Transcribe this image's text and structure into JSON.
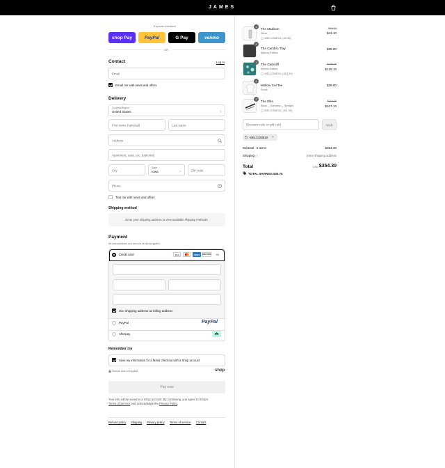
{
  "header": {
    "brand": "JAMES"
  },
  "express": {
    "title": "Express checkout",
    "buttons": [
      {
        "label": "shop Pay",
        "color": "#5a31f4"
      },
      {
        "label": "PayPal",
        "color": "#ffc439"
      },
      {
        "label": "G Pay",
        "color": "#000000"
      },
      {
        "label": "venmo",
        "color": "#3d95ce"
      }
    ],
    "or": "OR"
  },
  "contact": {
    "title": "Contact",
    "login": "Log in",
    "email_placeholder": "Email",
    "news_label": "Email me with news and offers"
  },
  "delivery": {
    "title": "Delivery",
    "country_label": "Country/Region",
    "country_value": "United States",
    "first_name": "First name (optional)",
    "last_name": "Last name",
    "address": "Address",
    "apartment": "Apartment, suite, etc. (optional)",
    "city": "City",
    "state_label": "State",
    "state_value": "Iowa",
    "zip": "ZIP code",
    "phone": "Phone",
    "text_label": "Text me with news and offers"
  },
  "shipping": {
    "title": "Shipping method",
    "note": "Enter your shipping address to view available shipping methods."
  },
  "payment": {
    "title": "Payment",
    "subtitle": "All transactions are secure and encrypted.",
    "credit_card": "Credit card",
    "card_logos": [
      "Visa",
      "MC",
      "AMEX",
      "DISCOVER"
    ],
    "more": "+5",
    "billing_label": "Use shipping address as billing address",
    "paypal": "PayPal",
    "paypal_logo": "PayPal",
    "afterpay": "Afterpay"
  },
  "remember": {
    "title": "Remember me",
    "save_label": "Save my information for a faster checkout with a Shop account",
    "secure": "Secure and encrypted",
    "shop": "shop"
  },
  "pay_now": "Pay now",
  "legal": {
    "line1": "Your info will be saved to a Shop account. By continuing, you agree to Shop's",
    "terms": "Terms of Service",
    "and": "and acknowledge the",
    "privacy": "Privacy Policy",
    "end": "."
  },
  "footer_links": [
    "Refund policy",
    "Shipping",
    "Privacy policy",
    "Terms of service",
    "Contact"
  ],
  "cart": {
    "items": [
      {
        "qty": "1",
        "name": "The Madison",
        "variant": "Silver",
        "discount": "WELCOME10 (-$4.90)",
        "old_price": "$49.00",
        "price": "$44.10",
        "thumb_color": "#e8e8e8"
      },
      {
        "qty": "1",
        "name": "The Cambro Tray",
        "variant": "Marlow Edition",
        "discount": "",
        "old_price": "",
        "price": "$39.00",
        "thumb_color": "#3a3a3a"
      },
      {
        "qty": "1",
        "name": "The Gatecliff",
        "variant": "Mollow Edition",
        "discount": "WELCOME10 (-$13.90)",
        "old_price": "$139.00",
        "price": "$125.10",
        "thumb_color": "#2f7a7a"
      },
      {
        "qty": "1",
        "name": "Mollow Cat Tee",
        "variant": "Small",
        "discount": "",
        "old_price": "",
        "price": "$39.00",
        "thumb_color": "#f2f2f2"
      },
      {
        "qty": "1",
        "name": "The Ellis",
        "variant": "Black – Damasso – Straight",
        "discount": "WELCOME10 (-$11.90)",
        "old_price": "$119.00",
        "price": "$107.10",
        "thumb_color": "#d8d8d8"
      }
    ],
    "discount_placeholder": "Discount code or gift card",
    "apply": "Apply",
    "applied_code": "WELCOME10",
    "subtotal_label": "Subtotal · 5 items",
    "subtotal": "$354.30",
    "shipping_label": "Shipping",
    "shipping_value": "Enter shipping address",
    "total_label": "Total",
    "currency": "USD",
    "total": "$354.30",
    "savings_label": "TOTAL SAVINGS",
    "savings": "$30.70"
  }
}
